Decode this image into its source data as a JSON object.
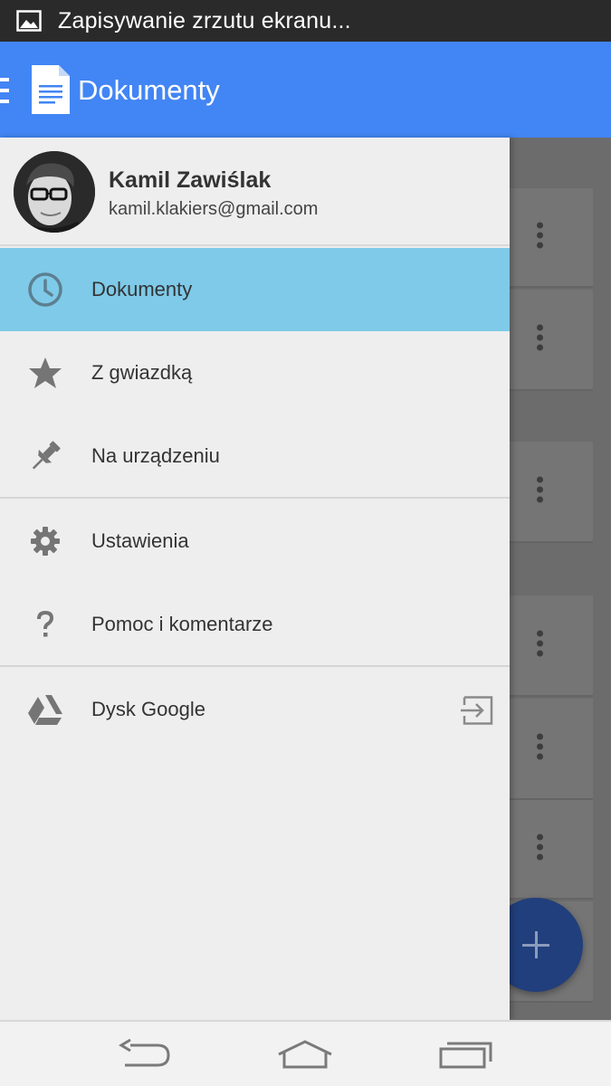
{
  "status_bar": {
    "text": "Zapisywanie zrzutu ekranu...",
    "icon": "image-icon"
  },
  "app_bar": {
    "title": "Dokumenty",
    "color": "#4285f4",
    "menu_icon": "hamburger-icon",
    "app_icon": "docs-icon"
  },
  "drawer": {
    "user": {
      "name": "Kamil Zawiślak",
      "email": "kamil.klakiers@gmail.com"
    },
    "items": [
      {
        "label": "Dokumenty",
        "icon": "clock-icon",
        "active": true
      },
      {
        "label": "Z gwiazdką",
        "icon": "star-icon",
        "active": false
      },
      {
        "label": "Na urządzeniu",
        "icon": "pin-icon",
        "active": false
      },
      {
        "label": "Ustawienia",
        "icon": "gear-icon",
        "active": false
      },
      {
        "label": "Pomoc i komentarze",
        "icon": "help-icon",
        "active": false
      },
      {
        "label": "Dysk Google",
        "icon": "drive-icon",
        "active": false,
        "trailing_icon": "open-external-icon"
      }
    ],
    "active_color": "#7ecae8"
  },
  "fab": {
    "icon": "plus-icon"
  },
  "nav_bar": {
    "buttons": [
      "back-icon",
      "home-icon",
      "recents-icon"
    ]
  }
}
